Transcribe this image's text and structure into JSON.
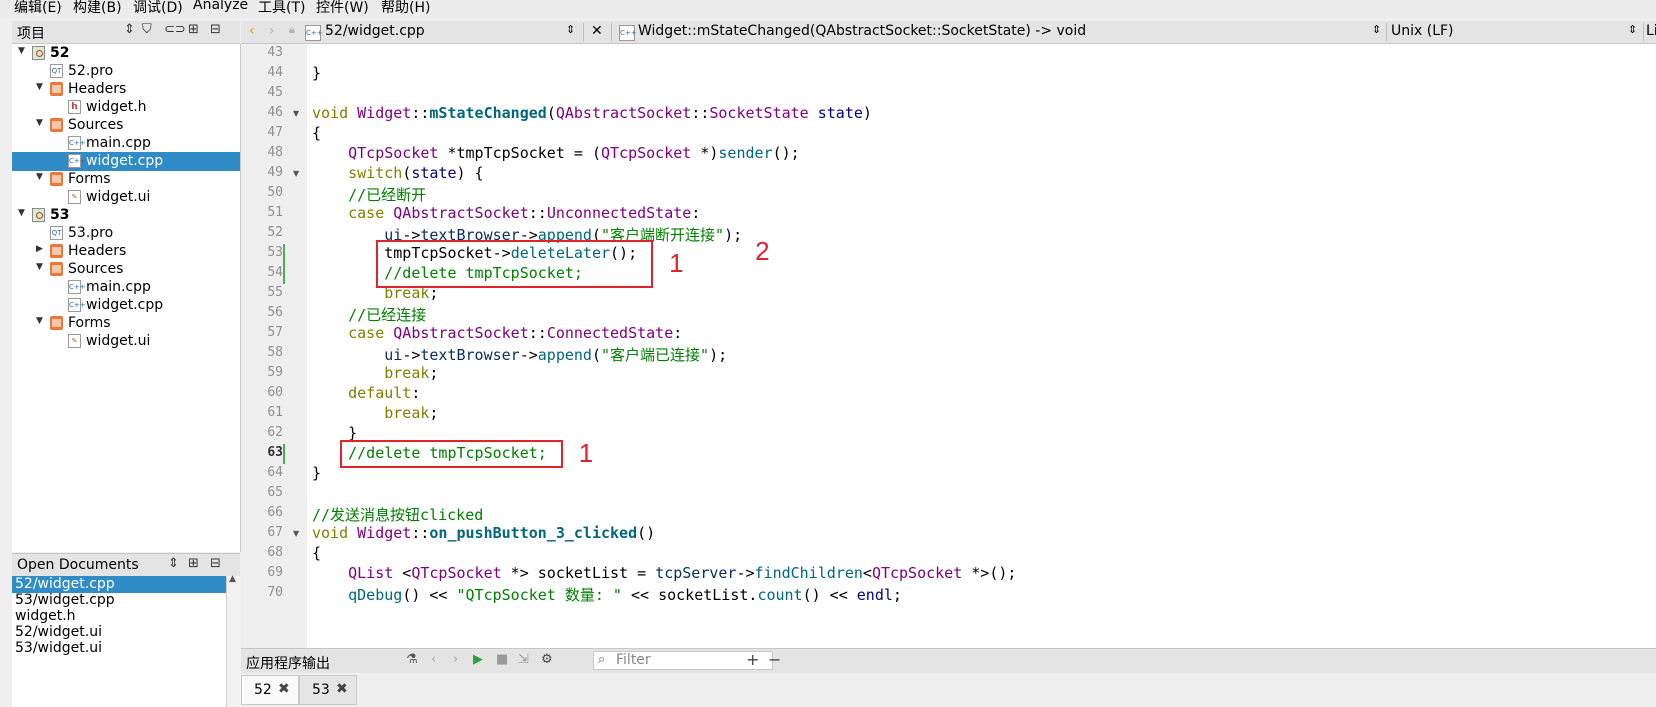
{
  "menu": [
    "编辑(E)",
    "构建(B)",
    "调试(D)",
    "Analyze",
    "工具(T)",
    "控件(W)",
    "帮助(H)"
  ],
  "project_panel": {
    "title": "项目",
    "tree": [
      {
        "label": "52",
        "bold": true,
        "depth": 0,
        "arrow": "▼",
        "icon": "project"
      },
      {
        "label": "52.pro",
        "depth": 1,
        "icon": "pro"
      },
      {
        "label": "Headers",
        "depth": 1,
        "arrow": "▼",
        "icon": "folder"
      },
      {
        "label": "widget.h",
        "depth": 2,
        "icon": "h"
      },
      {
        "label": "Sources",
        "depth": 1,
        "arrow": "▼",
        "icon": "folder"
      },
      {
        "label": "main.cpp",
        "depth": 2,
        "icon": "cpp"
      },
      {
        "label": "widget.cpp",
        "depth": 2,
        "icon": "cpp",
        "selected": true
      },
      {
        "label": "Forms",
        "depth": 1,
        "arrow": "▼",
        "icon": "folder"
      },
      {
        "label": "widget.ui",
        "depth": 2,
        "icon": "ui"
      },
      {
        "label": "53",
        "bold": true,
        "depth": 0,
        "arrow": "▼",
        "icon": "project"
      },
      {
        "label": "53.pro",
        "depth": 1,
        "icon": "pro"
      },
      {
        "label": "Headers",
        "depth": 1,
        "arrow": "▶",
        "icon": "folder"
      },
      {
        "label": "Sources",
        "depth": 1,
        "arrow": "▼",
        "icon": "folder"
      },
      {
        "label": "main.cpp",
        "depth": 2,
        "icon": "cpp"
      },
      {
        "label": "widget.cpp",
        "depth": 2,
        "icon": "cpp"
      },
      {
        "label": "Forms",
        "depth": 1,
        "arrow": "▼",
        "icon": "folder"
      },
      {
        "label": "widget.ui",
        "depth": 2,
        "icon": "ui"
      }
    ]
  },
  "open_documents": {
    "title": "Open Documents",
    "items": [
      "52/widget.cpp",
      "53/widget.cpp",
      "widget.h",
      "52/widget.ui",
      "53/widget.ui"
    ],
    "selected_index": 0
  },
  "editor_toolbar": {
    "file": "52/widget.cpp",
    "symbol": "Widget::mStateChanged(QAbstractSocket::SocketState) -> void",
    "line_ending": "Unix (LF)",
    "position_prefix": "Li"
  },
  "code": {
    "current_line": 63,
    "lines": [
      {
        "n": 43,
        "t": ""
      },
      {
        "n": 44,
        "t": "}"
      },
      {
        "n": 45,
        "t": ""
      },
      {
        "n": 46,
        "t": "void Widget::mStateChanged(QAbstractSocket::SocketState state)",
        "fold": true
      },
      {
        "n": 47,
        "t": "{"
      },
      {
        "n": 48,
        "t": "    QTcpSocket *tmpTcpSocket = (QTcpSocket *)sender();"
      },
      {
        "n": 49,
        "t": "    switch(state) {",
        "fold": true
      },
      {
        "n": 50,
        "t": "    //已经断开"
      },
      {
        "n": 51,
        "t": "    case QAbstractSocket::UnconnectedState:"
      },
      {
        "n": 52,
        "t": "        ui->textBrowser->append(\"客户端断开连接\");"
      },
      {
        "n": 53,
        "t": "        tmpTcpSocket->deleteLater();",
        "modified": true
      },
      {
        "n": 54,
        "t": "        //delete tmpTcpSocket;",
        "modified": true
      },
      {
        "n": 55,
        "t": "        break;"
      },
      {
        "n": 56,
        "t": "    //已经连接"
      },
      {
        "n": 57,
        "t": "    case QAbstractSocket::ConnectedState:"
      },
      {
        "n": 58,
        "t": "        ui->textBrowser->append(\"客户端已连接\");"
      },
      {
        "n": 59,
        "t": "        break;"
      },
      {
        "n": 60,
        "t": "    default:"
      },
      {
        "n": 61,
        "t": "        break;"
      },
      {
        "n": 62,
        "t": "    }"
      },
      {
        "n": 63,
        "t": "    //delete tmpTcpSocket;",
        "modified": true
      },
      {
        "n": 64,
        "t": "}"
      },
      {
        "n": 65,
        "t": ""
      },
      {
        "n": 66,
        "t": "//发送消息按钮clicked"
      },
      {
        "n": 67,
        "t": "void Widget::on_pushButton_3_clicked()",
        "fold": true
      },
      {
        "n": 68,
        "t": "{"
      },
      {
        "n": 69,
        "t": "    QList <QTcpSocket *> socketList = tcpServer->findChildren<QTcpSocket *>();"
      },
      {
        "n": 70,
        "t": "    qDebug() << \"QTcpSocket 数量: \" << socketList.count() << endl;"
      }
    ],
    "annotations": [
      {
        "label": "1",
        "first_line": 53,
        "last_line": 54
      },
      {
        "label": "2",
        "first_line": 53,
        "last_line": 53
      },
      {
        "label": "1",
        "first_line": 63,
        "last_line": 63
      }
    ]
  },
  "output_pane": {
    "title": "应用程序输出",
    "filter_placeholder": "Filter",
    "tabs": [
      {
        "label": "52",
        "active": true
      },
      {
        "label": "53",
        "active": false
      }
    ]
  },
  "colors": {
    "selection": "#308cc6",
    "annotation": "#e0242a",
    "comment": "#008000",
    "keyword": "#808000",
    "type": "#800080",
    "function": "#00677c",
    "modified_marker": "#4cae4c"
  }
}
